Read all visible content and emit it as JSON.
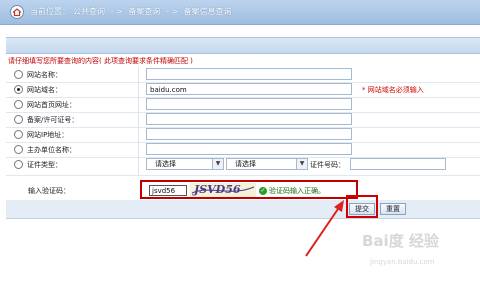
{
  "breadcrumb": {
    "prefix": "当前位置：",
    "items": [
      "公共查询",
      "备案查询",
      "备案信息查询"
    ],
    "separator": "- >"
  },
  "form": {
    "hint": "请仔细填写您所要查询的内容( 此项查询要求条件精确匹配 )",
    "fields": [
      {
        "label": "网站名称：",
        "value": "",
        "checked": false
      },
      {
        "label": "网站域名：",
        "value": "baidu.com",
        "checked": true,
        "required_note": "* 网站域名必须输入"
      },
      {
        "label": "网站首页网址：",
        "value": "",
        "checked": false
      },
      {
        "label": "备案/许可证号：",
        "value": "",
        "checked": false
      },
      {
        "label": "网站IP地址：",
        "value": "",
        "checked": false
      },
      {
        "label": "主办单位名称：",
        "value": "",
        "checked": false
      }
    ],
    "cert": {
      "label": "证件类型：",
      "select1": "请选择",
      "select2": "请选择",
      "number_label": "证件号码：",
      "number_value": ""
    },
    "captcha": {
      "label": "输入验证码：",
      "input_value": "jsvd56",
      "image_text": "JSVD56",
      "ok_text": "验证码输入正确。"
    },
    "buttons": {
      "submit": "提交",
      "reset": "重置"
    }
  },
  "watermark": {
    "text": "Bai度 经验",
    "sub": "jingyan.baidu.com"
  },
  "colors": {
    "highlight": "#d00000",
    "required": "#d00000",
    "accent_bar": "#9fbde0"
  }
}
